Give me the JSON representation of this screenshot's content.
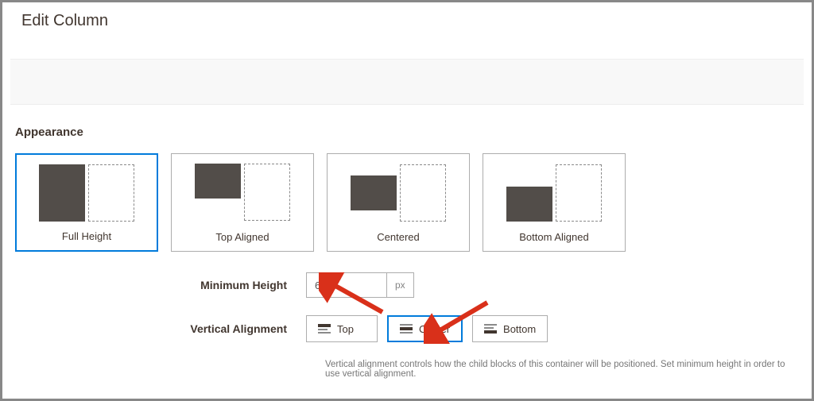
{
  "header": {
    "title": "Edit Column"
  },
  "appearance": {
    "section_title": "Appearance",
    "options": [
      {
        "label": "Full Height"
      },
      {
        "label": "Top Aligned"
      },
      {
        "label": "Centered"
      },
      {
        "label": "Bottom Aligned"
      }
    ],
    "selected_index": 0
  },
  "min_height": {
    "label": "Minimum Height",
    "value": "650",
    "unit": "px"
  },
  "vertical_alignment": {
    "label": "Vertical Alignment",
    "options": [
      {
        "label": "Top"
      },
      {
        "label": "Center"
      },
      {
        "label": "Bottom"
      }
    ],
    "selected_index": 1,
    "hint": "Vertical alignment controls how the child blocks of this container will be positioned. Set minimum height in order to use vertical alignment."
  }
}
